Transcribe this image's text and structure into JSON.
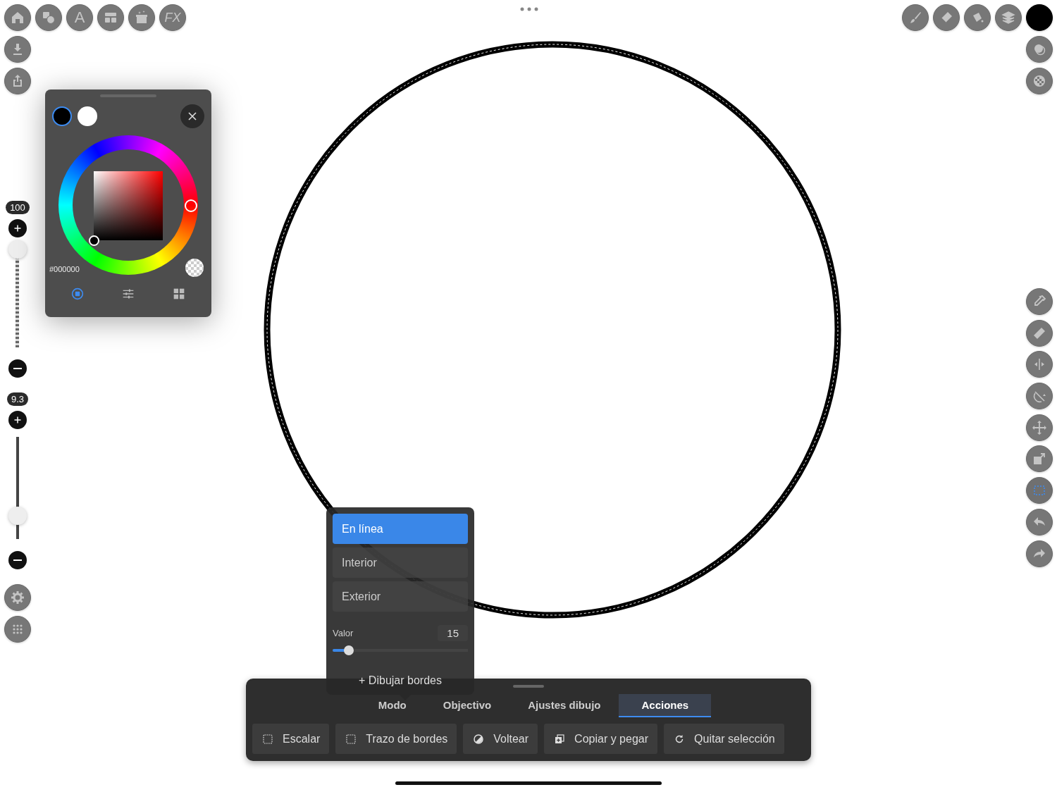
{
  "top_toolbar": {
    "text_tool": "A",
    "fx_label": "FX"
  },
  "sliders": [
    {
      "reading": "100",
      "level": 0.96
    },
    {
      "reading": "9.3",
      "level": 0.23
    }
  ],
  "color_picker": {
    "swatches": [
      {
        "color": "#000000",
        "selected": true
      },
      {
        "color": "#ffffff",
        "selected": false
      }
    ],
    "hex": "#000000",
    "views": [
      {
        "selected": true
      },
      {
        "selected": false
      },
      {
        "selected": false
      }
    ]
  },
  "right_tools": [
    {
      "selected": false
    },
    {
      "selected": false
    },
    {
      "selected": false
    },
    {
      "selected": false
    },
    {
      "selected": false
    },
    {
      "selected": false
    },
    {
      "selected": true
    },
    {
      "selected": false
    },
    {
      "selected": false
    }
  ],
  "mode_popup": {
    "options": [
      {
        "label": "En línea",
        "selected": true
      },
      {
        "label": "Interior",
        "selected": false
      },
      {
        "label": "Exterior",
        "selected": false
      }
    ],
    "value_label": "Valor",
    "value": "15",
    "level": 0.12,
    "action": "+ Dibujar bordes"
  },
  "bottom_panel": {
    "tabs": [
      {
        "label": "Modo",
        "selected": false
      },
      {
        "label": "Objectivo",
        "selected": false
      },
      {
        "label": "Ajustes dibujo",
        "selected": false
      },
      {
        "label": "Acciones",
        "selected": true
      }
    ],
    "actions": [
      {
        "label": "Escalar"
      },
      {
        "label": "Trazo de bordes"
      },
      {
        "label": "Voltear"
      },
      {
        "label": "Copiar y pegar"
      },
      {
        "label": "Quitar selección"
      }
    ]
  }
}
